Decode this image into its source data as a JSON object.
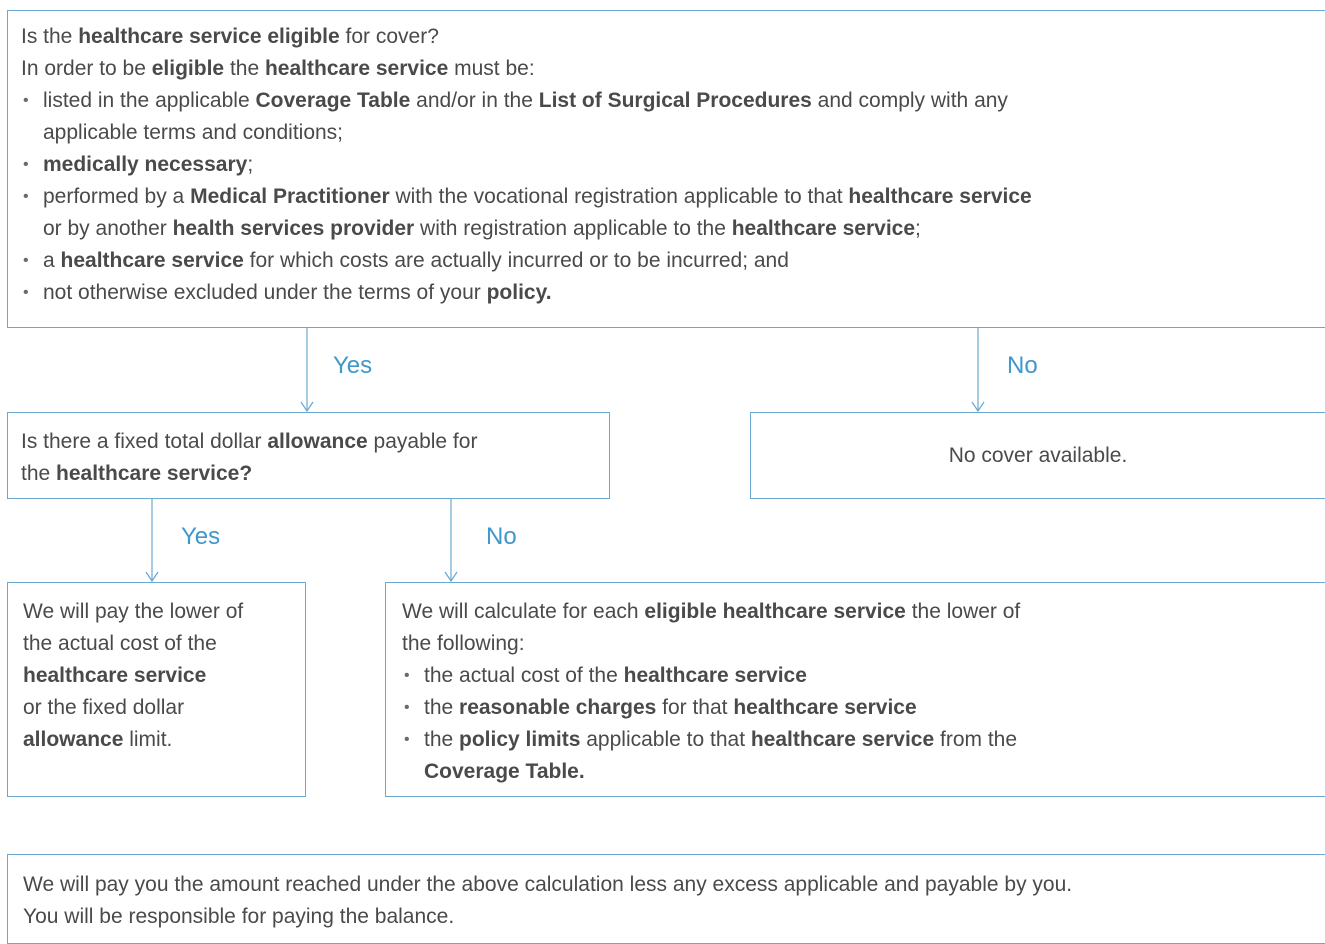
{
  "q1": {
    "title": [
      {
        "t": "Is the "
      },
      {
        "t": "healthcare service eligible",
        "b": true
      },
      {
        "t": " for cover?"
      }
    ],
    "intro": [
      {
        "t": "In order to be "
      },
      {
        "t": "eligible",
        "b": true
      },
      {
        "t": " the "
      },
      {
        "t": "healthcare service",
        "b": true
      },
      {
        "t": " must be:"
      }
    ],
    "bullets": [
      [
        [
          {
            "t": "listed in the applicable "
          },
          {
            "t": "Coverage Table",
            "b": true
          },
          {
            "t": " and/or in the "
          },
          {
            "t": "List of Surgical Procedures",
            "b": true
          },
          {
            "t": " and comply with any"
          }
        ],
        [
          {
            "t": "applicable terms and conditions;"
          }
        ]
      ],
      [
        [
          {
            "t": "medically necessary",
            "b": true
          },
          {
            "t": ";"
          }
        ]
      ],
      [
        [
          {
            "t": "performed by a "
          },
          {
            "t": "Medical Practitioner",
            "b": true
          },
          {
            "t": " with the vocational registration applicable to that "
          },
          {
            "t": "healthcare service",
            "b": true
          }
        ],
        [
          {
            "t": "or by another "
          },
          {
            "t": "health services provider",
            "b": true
          },
          {
            "t": " with registration applicable to the "
          },
          {
            "t": "healthcare service",
            "b": true
          },
          {
            "t": ";"
          }
        ]
      ],
      [
        [
          {
            "t": "a "
          },
          {
            "t": "healthcare service",
            "b": true
          },
          {
            "t": " for which costs are actually incurred or to be incurred; and"
          }
        ]
      ],
      [
        [
          {
            "t": "not otherwise excluded under the terms of your "
          },
          {
            "t": "policy.",
            "b": true
          }
        ]
      ]
    ]
  },
  "labels": {
    "yes1": "Yes",
    "no1": "No",
    "yes2": "Yes",
    "no2": "No"
  },
  "q2": {
    "lines": [
      [
        {
          "t": "Is there a fixed total dollar "
        },
        {
          "t": "allowance",
          "b": true
        },
        {
          "t": " payable for"
        }
      ],
      [
        {
          "t": "the "
        },
        {
          "t": "healthcare service?",
          "b": true
        }
      ]
    ]
  },
  "no_cover": {
    "text": "No cover available."
  },
  "pay_lower": {
    "lines": [
      [
        {
          "t": "We will pay the lower of"
        }
      ],
      [
        {
          "t": "the actual cost of the"
        }
      ],
      [
        {
          "t": "healthcare service",
          "b": true
        }
      ],
      [
        {
          "t": "or the fixed dollar"
        }
      ],
      [
        {
          "t": "allowance",
          "b": true
        },
        {
          "t": " limit."
        }
      ]
    ]
  },
  "calc": {
    "intro": [
      [
        {
          "t": "We will calculate for each "
        },
        {
          "t": "eligible healthcare service",
          "b": true
        },
        {
          "t": " the lower of"
        }
      ],
      [
        {
          "t": "the following:"
        }
      ]
    ],
    "bullets": [
      [
        [
          {
            "t": "the actual cost of the "
          },
          {
            "t": "healthcare service",
            "b": true
          }
        ]
      ],
      [
        [
          {
            "t": "the "
          },
          {
            "t": "reasonable charges",
            "b": true
          },
          {
            "t": " for that "
          },
          {
            "t": "healthcare service",
            "b": true
          }
        ]
      ],
      [
        [
          {
            "t": "the "
          },
          {
            "t": "policy limits",
            "b": true
          },
          {
            "t": " applicable to that "
          },
          {
            "t": "healthcare service",
            "b": true
          },
          {
            "t": " from the"
          }
        ],
        [
          {
            "t": "Coverage Table.",
            "b": true
          }
        ]
      ]
    ]
  },
  "final": {
    "lines": [
      [
        {
          "t": "We will pay you the amount reached under the above calculation less any excess applicable and payable by you."
        }
      ],
      [
        {
          "t": "You will be responsible for paying the balance."
        }
      ]
    ]
  }
}
